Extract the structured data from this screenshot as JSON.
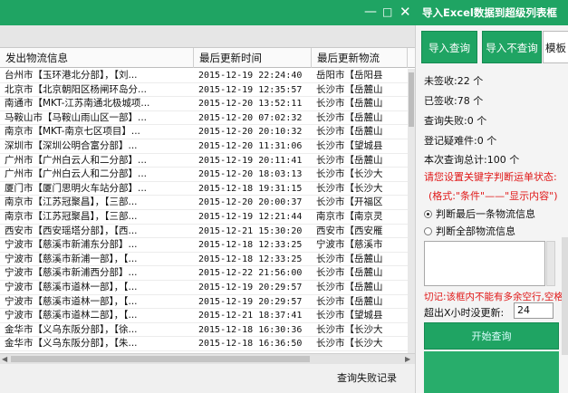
{
  "window": {
    "title": "导入Excel数据到超级列表框",
    "min_glyph": "—",
    "max_glyph": "□",
    "close_glyph": "✕"
  },
  "table": {
    "columns": [
      "发出物流信息",
      "最后更新时间",
      "最后更新物流"
    ],
    "rows": [
      {
        "info": "台州市【玉环港北分部】，【刘...",
        "time": "2015-12-19 22:24:40",
        "latest": "岳阳市【岳阳县"
      },
      {
        "info": "北京市【北京朝阳区杨闸环岛分...",
        "time": "2015-12-19 12:35:57",
        "latest": "长沙市【岳麓山"
      },
      {
        "info": "南通市【MKT-江苏南通北极城项...",
        "time": "2015-12-20 13:52:11",
        "latest": "长沙市【岳麓山"
      },
      {
        "info": "马鞍山市【马鞍山雨山区一部】...",
        "time": "2015-12-20 07:02:32",
        "latest": "长沙市【岳麓山"
      },
      {
        "info": "南京市【MKT-南京七区项目】...",
        "time": "2015-12-20 20:10:32",
        "latest": "长沙市【岳麓山"
      },
      {
        "info": "深圳市【深圳公明合富分部】...",
        "time": "2015-12-20 11:31:06",
        "latest": "长沙市【望城县"
      },
      {
        "info": "广州市【广州白云人和二分部】...",
        "time": "2015-12-19 20:11:41",
        "latest": "长沙市【岳麓山"
      },
      {
        "info": "广州市【广州白云人和二分部】...",
        "time": "2015-12-20 18:03:13",
        "latest": "长沙市【长沙大"
      },
      {
        "info": "厦门市【厦门思明火车站分部】...",
        "time": "2015-12-18 19:31:15",
        "latest": "长沙市【长沙大"
      },
      {
        "info": "南京市【江苏冠聚昌】，【三部...",
        "time": "2015-12-20 20:00:37",
        "latest": "长沙市【开福区"
      },
      {
        "info": "南京市【江苏冠聚昌】，【三部...",
        "time": "2015-12-19 12:21:44",
        "latest": "南京市【南京灵"
      },
      {
        "info": "西安市【西安瑶塔分部】，【西...",
        "time": "2015-12-21 15:30:20",
        "latest": "西安市【西安雁"
      },
      {
        "info": "宁波市【慈溪市新浦东分部】...",
        "time": "2015-12-18 12:33:25",
        "latest": "宁波市【慈溪市"
      },
      {
        "info": "宁波市【慈溪市新浦一部】，【...",
        "time": "2015-12-18 12:33:25",
        "latest": "长沙市【岳麓山"
      },
      {
        "info": "宁波市【慈溪市新浦西分部】...",
        "time": "2015-12-22 21:56:00",
        "latest": "长沙市【岳麓山"
      },
      {
        "info": "宁波市【慈溪市道林一部】，【...",
        "time": "2015-12-19 20:29:57",
        "latest": "长沙市【岳麓山"
      },
      {
        "info": "宁波市【慈溪市道林一部】，【...",
        "time": "2015-12-19 20:29:57",
        "latest": "长沙市【岳麓山"
      },
      {
        "info": "宁波市【慈溪市道林二部】，【...",
        "time": "2015-12-21 18:37:41",
        "latest": "长沙市【望城县"
      },
      {
        "info": "金华市【义乌东阪分部】，【徐...",
        "time": "2015-12-18 16:30:36",
        "latest": "长沙市【长沙大"
      },
      {
        "info": "金华市【义乌东阪分部】，【朱...",
        "time": "2015-12-18 16:36:50",
        "latest": "长沙市【长沙大"
      }
    ]
  },
  "status": {
    "fail_records_link": "查询失败记录"
  },
  "panel": {
    "import_query_button": "导入查询",
    "import_noquery_button": "导入不查询",
    "template_button": "模板",
    "unsigned": "未签收:22 个",
    "signed": "已签收:78 个",
    "query_failed": "查询失败:0 个",
    "suspect": "登记疑难件:0 个",
    "total": "本次查询总计:100 个",
    "hint_keywords": "请您设置关键字判断运单状态:",
    "hint_format": "(格式:\"条件\"——\"显示内容\")",
    "radio_last": "判断最后一条物流信息",
    "radio_all": "判断全部物流信息",
    "warning": "切记:该框内不能有多余空行,空格",
    "hours_label": "超出X小时没更新:",
    "hours_value": "24",
    "start_button": "开始查询"
  },
  "colors": {
    "accent_green": "#1fa463",
    "warning_red": "#e01818"
  }
}
